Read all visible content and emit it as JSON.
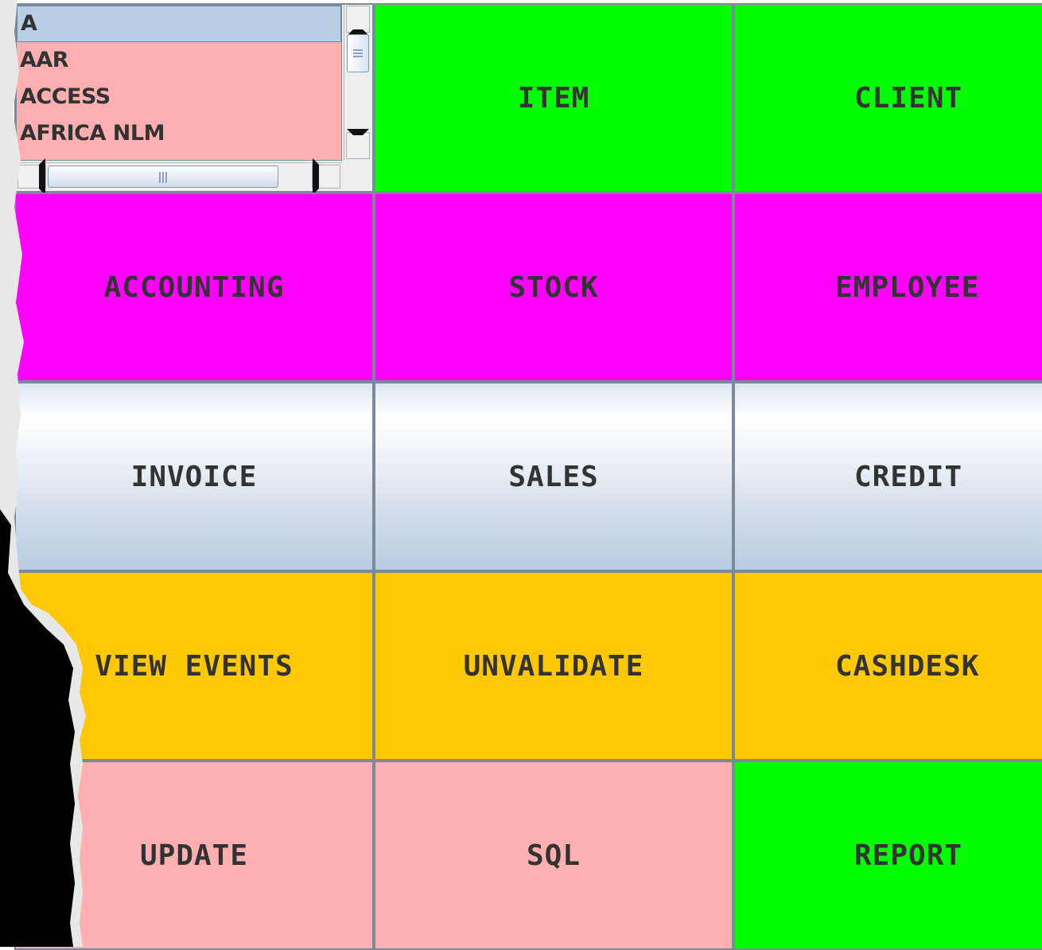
{
  "list": {
    "items": [
      {
        "label": "A",
        "selected": true
      },
      {
        "label": "AAR",
        "selected": false
      },
      {
        "label": "ACCESS",
        "selected": false
      },
      {
        "label": "AFRICA NLM",
        "selected": false
      }
    ]
  },
  "buttons": {
    "item": "ITEM",
    "client": "CLIENT",
    "accounting": "ACCOUNTING",
    "stock": "STOCK",
    "employee": "EMPLOYEE",
    "invoice": "INVOICE",
    "sales": "SALES",
    "credit": "CREDIT",
    "view_events": "VIEW EVENTS",
    "unvalidate": "UNVALIDATE",
    "cashdesk": "CASHDESK",
    "update": "UPDATE",
    "sql": "SQL",
    "report": "REPORT"
  },
  "colors": {
    "green": "#00ff00",
    "magenta": "#ff00ff",
    "orange": "#ffc800",
    "pink": "#ffafaf",
    "metal_light": "#ffffff",
    "metal_dark": "#b8cce2",
    "text": "#333333",
    "grid_line": "#7b8a9a",
    "list_selection": "#b8cfe5"
  },
  "icons": {
    "scroll_up": "triangle-up-icon",
    "scroll_down": "triangle-down-icon",
    "scroll_left": "triangle-left-icon",
    "scroll_right": "triangle-right-icon"
  }
}
